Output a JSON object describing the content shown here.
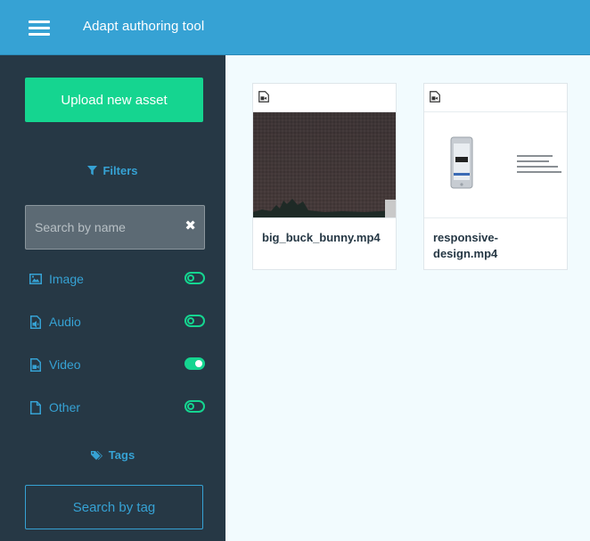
{
  "header": {
    "app_title": "Adapt authoring tool"
  },
  "sidebar": {
    "upload_label": "Upload new asset",
    "filters_title": "Filters",
    "search": {
      "placeholder": "Search by name",
      "value": ""
    },
    "filters": [
      {
        "label": "Image",
        "icon": "image-icon",
        "enabled": false
      },
      {
        "label": "Audio",
        "icon": "audio-file-icon",
        "enabled": false
      },
      {
        "label": "Video",
        "icon": "video-file-icon",
        "enabled": true
      },
      {
        "label": "Other",
        "icon": "file-icon",
        "enabled": false
      }
    ],
    "tags_title": "Tags",
    "tag_search_label": "Search by tag"
  },
  "assets": [
    {
      "name": "big_buck_bunny.mp4",
      "type_icon": "video-file-icon"
    },
    {
      "name": "responsive-design.mp4",
      "name_line1": "responsive-",
      "name_line2": "design.mp4",
      "type_icon": "video-file-icon"
    }
  ],
  "colors": {
    "header": "#36a2d4",
    "sidebar": "#263845",
    "accent_green": "#15d590",
    "accent_blue": "#36a2d4"
  }
}
